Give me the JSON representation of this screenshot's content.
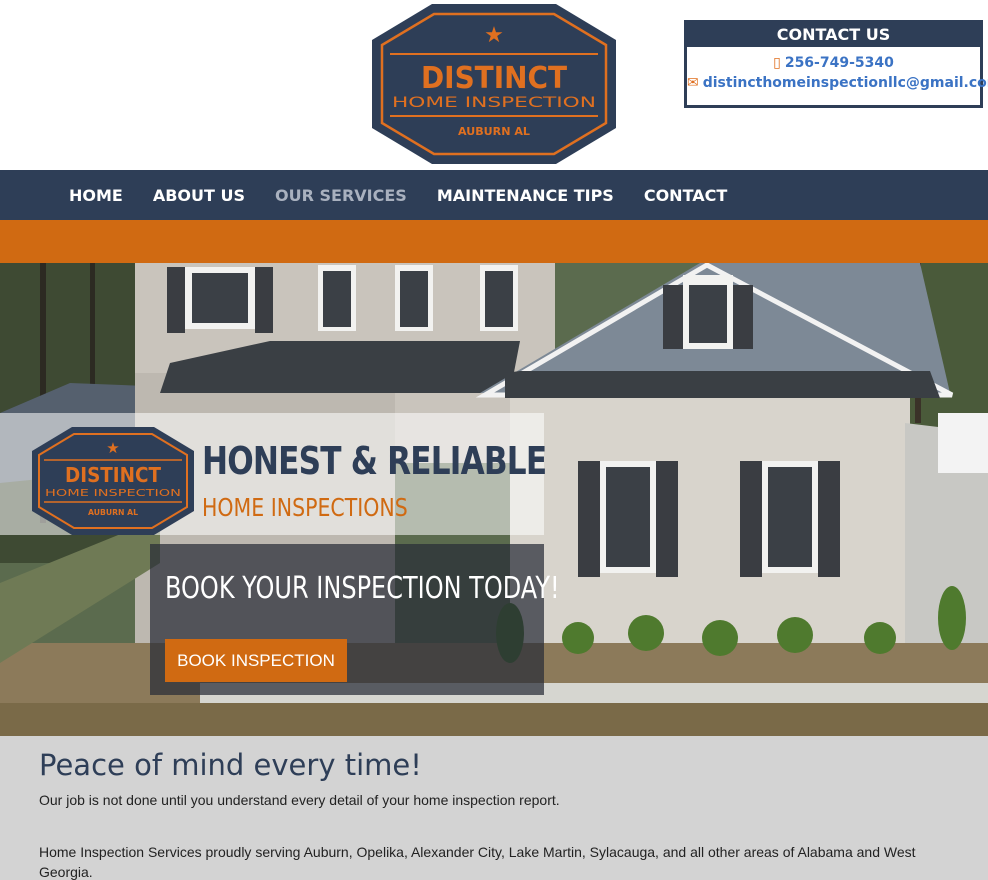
{
  "logo": {
    "title": "DISTINCT",
    "subtitle": "HOME INSPECTION",
    "location": "AUBURN AL"
  },
  "contact": {
    "heading": "CONTACT US",
    "phone": "256-749-5340",
    "email": "distincthomeinspectionllc@gmail.com",
    "phone_icon": "mobile-phone-icon",
    "email_icon": "envelope-icon"
  },
  "nav": {
    "items": [
      {
        "label": "HOME"
      },
      {
        "label": "ABOUT US"
      },
      {
        "label": "OUR SERVICES"
      },
      {
        "label": "MAINTENANCE TIPS"
      },
      {
        "label": "CONTACT"
      }
    ],
    "active": "OUR SERVICES"
  },
  "hero": {
    "title": "HONEST & RELIABLE",
    "subtitle": "HOME INSPECTIONS",
    "cta_heading": "BOOK YOUR INSPECTION TODAY!",
    "cta_button": "BOOK INSPECTION"
  },
  "content": {
    "heading": "Peace of mind every time!",
    "paragraph1": "Our job is not done until you understand every detail of your home inspection report.",
    "paragraph2": "Home Inspection Services proudly serving Auburn, Opelika, Alexander City, Lake Martin, Sylacauga, and all other areas of Alabama and West Georgia."
  },
  "colors": {
    "navy": "#2e3e57",
    "orange": "#d06a12",
    "link_blue": "#3b73c4",
    "content_bg": "#d3d3d3"
  }
}
